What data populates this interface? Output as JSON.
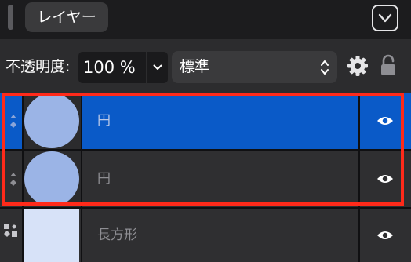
{
  "panel": {
    "tab_label": "レイヤー",
    "collapse_icon": "chevron-down-icon"
  },
  "toolbar": {
    "opacity_label": "不透明度:",
    "opacity_value": "100 %",
    "blend_mode": "標準",
    "settings_icon": "gear-icon",
    "lock_icon": "lock-icon"
  },
  "layers": [
    {
      "name": "円",
      "shape": "circle",
      "selected": true,
      "visible": true
    },
    {
      "name": "円",
      "shape": "circle",
      "selected": false,
      "visible": true
    },
    {
      "name": "長方形",
      "shape": "rectangle",
      "selected": false,
      "visible": true
    }
  ],
  "colors": {
    "selection": "#0a5ac8",
    "highlight_frame": "#ff2a1a",
    "shape_fill": "#9bb4e6",
    "rect_fill": "#d7e2f8"
  }
}
